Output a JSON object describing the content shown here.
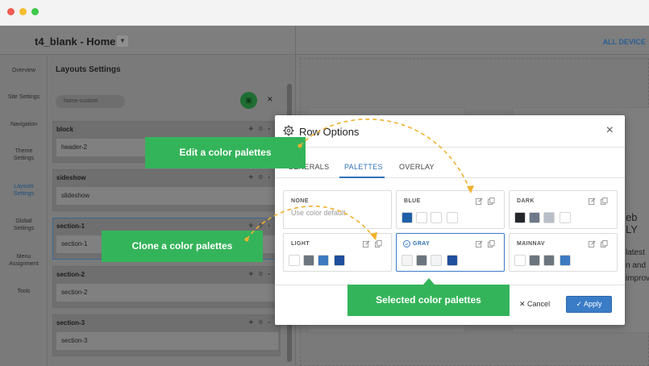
{
  "app": {
    "site_title": "t4_blank - Home",
    "all_devices": "ALL DEVICE"
  },
  "sidenav": {
    "items": [
      {
        "label": "Overview"
      },
      {
        "label": "Site Settings"
      },
      {
        "label": "Navigation"
      },
      {
        "label": "Theme Settings"
      },
      {
        "label": "Layouts Settings"
      },
      {
        "label": "Global Settings"
      },
      {
        "label": "Menu Assignment"
      },
      {
        "label": "Tools"
      }
    ]
  },
  "panel": {
    "title": "Layouts Settings",
    "preset": "home-custom",
    "sections": [
      {
        "name": "block",
        "field": "header-2"
      },
      {
        "name": "sideshow",
        "field": "slideshow"
      },
      {
        "name": "section-1",
        "field": "section-1"
      },
      {
        "name": "section-2",
        "field": "section-2"
      },
      {
        "name": "section-3",
        "field": "section-3"
      }
    ]
  },
  "canvas": {
    "text_lines": [
      "eb",
      "LY",
      "latest",
      "n and",
      "improv"
    ]
  },
  "callouts": {
    "edit": "Edit a color palettes",
    "clone": "Clone a color palettes",
    "selected": "Selected color palettes"
  },
  "modal": {
    "title": "Row Options",
    "close": "×",
    "tabs": [
      {
        "label": "GENERALS"
      },
      {
        "label": "PALETTES"
      },
      {
        "label": "OVERLAY"
      }
    ],
    "palettes": [
      {
        "name": "NONE",
        "default_text": "Use color default",
        "swatches": []
      },
      {
        "name": "BLUE",
        "swatches": [
          "#1f5fa8",
          "#ffffff",
          "#ffffff",
          "#ffffff"
        ]
      },
      {
        "name": "DARK",
        "swatches": [
          "#23262b",
          "#6d7889",
          "#b9bfc9",
          "#ffffff"
        ]
      },
      {
        "name": "LIGHT",
        "swatches": [
          "#ffffff",
          "#6c757d",
          "#3c7ac2",
          "#1f4f9d"
        ]
      },
      {
        "name": "GRAY",
        "swatches": [
          "#f4f4f4",
          "#6c757d",
          "#f2f3f5",
          "#1f4f9d"
        ]
      },
      {
        "name": "MAINNAV",
        "swatches": [
          "#ffffff",
          "#6c757d",
          "#6c757d",
          "#3c7ac2"
        ]
      }
    ],
    "cancel_label": "Cancel",
    "apply_label": "Apply"
  }
}
